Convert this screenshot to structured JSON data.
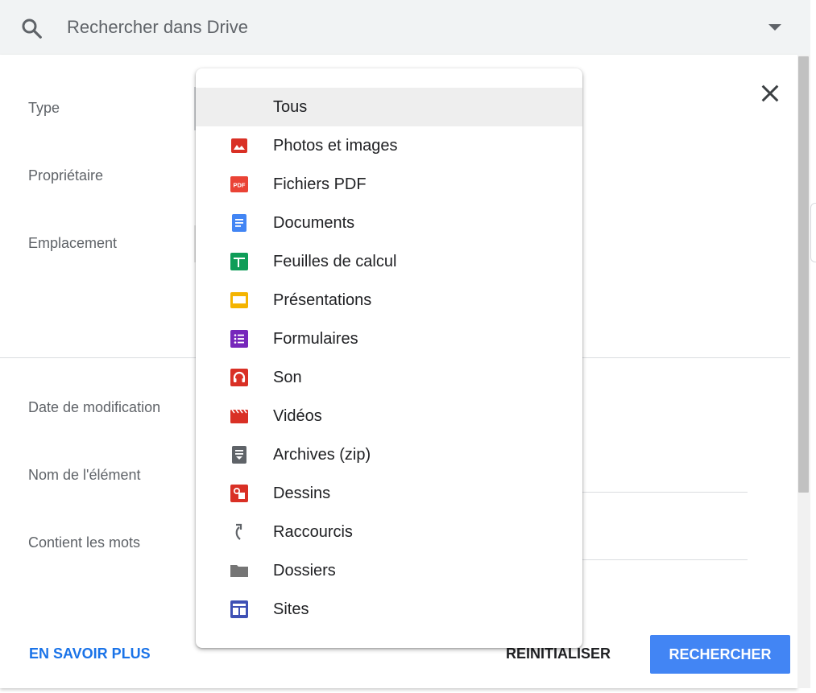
{
  "search": {
    "placeholder": "Rechercher dans Drive"
  },
  "panel": {
    "labels": {
      "type": "Type",
      "owner": "Propriétaire",
      "location": "Emplacement",
      "modified": "Date de modification",
      "item_name": "Nom de l'élément",
      "contains": "Contient les mots"
    },
    "learn_more": "EN SAVOIR PLUS",
    "reset": "REINITIALISER",
    "search": "RECHERCHER"
  },
  "type_menu": {
    "selected": "Tous",
    "items": [
      {
        "label": "Tous",
        "icon": ""
      },
      {
        "label": "Photos et images",
        "icon": "image-icon",
        "color": "#d93025"
      },
      {
        "label": "Fichiers PDF",
        "icon": "pdf-icon",
        "color": "#ea4335"
      },
      {
        "label": "Documents",
        "icon": "docs-icon",
        "color": "#4285f4"
      },
      {
        "label": "Feuilles de calcul",
        "icon": "sheets-icon",
        "color": "#0f9d58"
      },
      {
        "label": "Présentations",
        "icon": "slides-icon",
        "color": "#f4b400"
      },
      {
        "label": "Formulaires",
        "icon": "forms-icon",
        "color": "#7627bb"
      },
      {
        "label": "Son",
        "icon": "audio-icon",
        "color": "#d93025"
      },
      {
        "label": "Vidéos",
        "icon": "video-icon",
        "color": "#d93025"
      },
      {
        "label": "Archives (zip)",
        "icon": "archive-icon",
        "color": "#5f6368"
      },
      {
        "label": "Dessins",
        "icon": "drawings-icon",
        "color": "#d93025"
      },
      {
        "label": "Raccourcis",
        "icon": "shortcut-icon",
        "color": "#5f6368"
      },
      {
        "label": "Dossiers",
        "icon": "folder-icon",
        "color": "#757575"
      },
      {
        "label": "Sites",
        "icon": "sites-icon",
        "color": "#3f51b5"
      }
    ]
  }
}
